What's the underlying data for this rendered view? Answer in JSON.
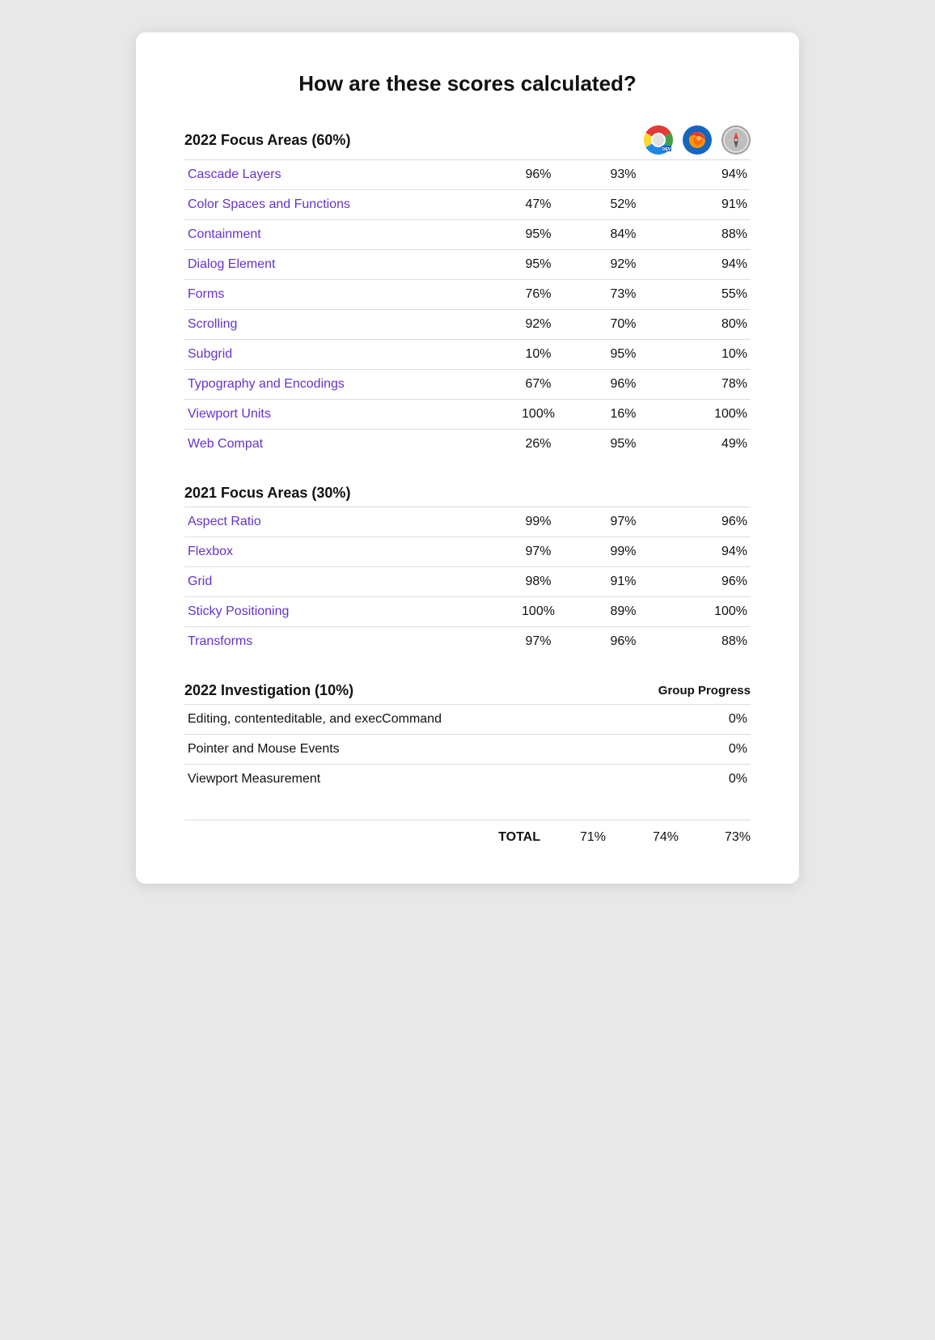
{
  "page": {
    "title": "How are these scores calculated?"
  },
  "section2022": {
    "title": "2022 Focus Areas (60%)",
    "browsers": [
      "Chrome Dev",
      "Firefox",
      "Safari"
    ],
    "rows": [
      {
        "name": "Cascade Layers",
        "scores": [
          "96%",
          "93%",
          "94%"
        ]
      },
      {
        "name": "Color Spaces and Functions",
        "scores": [
          "47%",
          "52%",
          "91%"
        ]
      },
      {
        "name": "Containment",
        "scores": [
          "95%",
          "84%",
          "88%"
        ]
      },
      {
        "name": "Dialog Element",
        "scores": [
          "95%",
          "92%",
          "94%"
        ]
      },
      {
        "name": "Forms",
        "scores": [
          "76%",
          "73%",
          "55%"
        ]
      },
      {
        "name": "Scrolling",
        "scores": [
          "92%",
          "70%",
          "80%"
        ]
      },
      {
        "name": "Subgrid",
        "scores": [
          "10%",
          "95%",
          "10%"
        ]
      },
      {
        "name": "Typography and Encodings",
        "scores": [
          "67%",
          "96%",
          "78%"
        ]
      },
      {
        "name": "Viewport Units",
        "scores": [
          "100%",
          "16%",
          "100%"
        ]
      },
      {
        "name": "Web Compat",
        "scores": [
          "26%",
          "95%",
          "49%"
        ]
      }
    ]
  },
  "section2021": {
    "title": "2021 Focus Areas (30%)",
    "rows": [
      {
        "name": "Aspect Ratio",
        "scores": [
          "99%",
          "97%",
          "96%"
        ]
      },
      {
        "name": "Flexbox",
        "scores": [
          "97%",
          "99%",
          "94%"
        ]
      },
      {
        "name": "Grid",
        "scores": [
          "98%",
          "91%",
          "96%"
        ]
      },
      {
        "name": "Sticky Positioning",
        "scores": [
          "100%",
          "89%",
          "100%"
        ]
      },
      {
        "name": "Transforms",
        "scores": [
          "97%",
          "96%",
          "88%"
        ]
      }
    ]
  },
  "section2022inv": {
    "title": "2022 Investigation (10%)",
    "groupProgressLabel": "Group Progress",
    "rows": [
      {
        "name": "Editing, contenteditable, and execCommand",
        "score": "0%"
      },
      {
        "name": "Pointer and Mouse Events",
        "score": "0%"
      },
      {
        "name": "Viewport Measurement",
        "score": "0%"
      }
    ]
  },
  "totals": {
    "label": "TOTAL",
    "scores": [
      "71%",
      "74%",
      "73%"
    ]
  }
}
